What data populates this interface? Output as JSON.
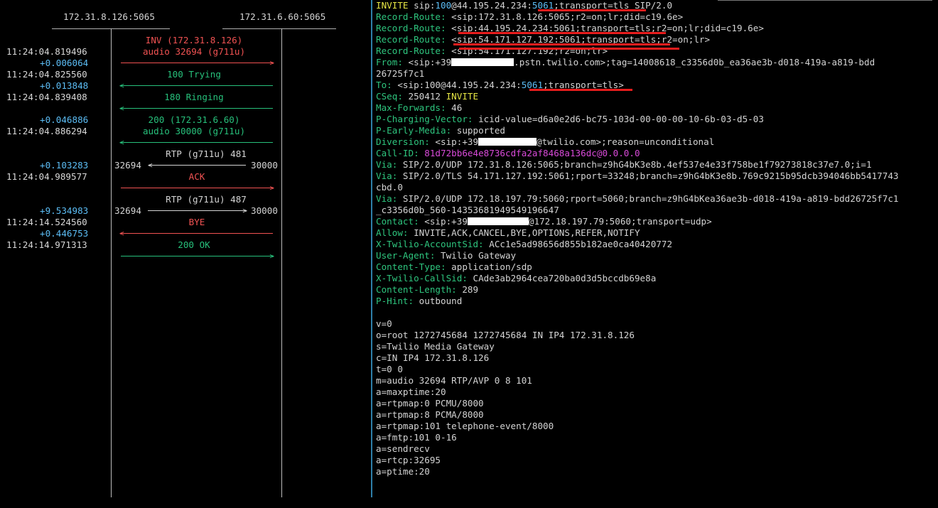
{
  "ladder": {
    "hosts": [
      "172.31.8.126:5065",
      "172.31.6.60:5065"
    ],
    "events": [
      {
        "timestamp": "",
        "delta": "",
        "label": "INV (172.31.8.126)",
        "color": "red"
      },
      {
        "timestamp": "11:24:04.819496",
        "delta": "",
        "label": "audio 32694 (g711u)",
        "color": "red"
      },
      {
        "timestamp": "",
        "delta": "+0.006064",
        "label": "",
        "color": ""
      },
      {
        "timestamp": "11:24:04.825560",
        "delta": "",
        "label": "100 Trying",
        "color": "green"
      },
      {
        "timestamp": "",
        "delta": "+0.013848",
        "label": "",
        "color": ""
      },
      {
        "timestamp": "11:24:04.839408",
        "delta": "",
        "label": "180 Ringing",
        "color": "green"
      },
      {
        "timestamp": "",
        "delta": "+0.046886",
        "label": "200 (172.31.6.60)",
        "color": "green"
      },
      {
        "timestamp": "11:24:04.886294",
        "delta": "",
        "label": "audio 30000 (g711u)",
        "color": "green"
      },
      {
        "timestamp": "",
        "delta": "",
        "label": "RTP (g711u) 481",
        "color": "grey"
      },
      {
        "timestamp": "",
        "delta": "+0.103283",
        "label": "",
        "color": ""
      },
      {
        "timestamp": "11:24:04.989577",
        "delta": "",
        "label": "ACK",
        "color": "red"
      },
      {
        "timestamp": "",
        "delta": "",
        "label": "RTP (g711u) 487",
        "color": "grey"
      },
      {
        "timestamp": "",
        "delta": "+9.534983",
        "label": "",
        "color": ""
      },
      {
        "timestamp": "11:24:14.524560",
        "delta": "",
        "label": "BYE",
        "color": "red"
      },
      {
        "timestamp": "",
        "delta": "+0.446753",
        "label": "",
        "color": ""
      },
      {
        "timestamp": "11:24:14.971313",
        "delta": "",
        "label": "200 OK",
        "color": "green"
      }
    ],
    "rtp_streams": [
      {
        "left_port": "32694",
        "right_port": "30000",
        "direction": "left"
      },
      {
        "left_port": "32694",
        "right_port": "30000",
        "direction": "right"
      }
    ]
  },
  "message": {
    "lines": [
      {
        "segments": [
          {
            "t": "INVITE",
            "c": "y"
          },
          {
            "t": " sip:",
            "c": ""
          },
          {
            "t": "100",
            "c": "lb"
          },
          {
            "t": "@44.195.24.234:",
            "c": ""
          },
          {
            "t": "5061",
            "c": "lb"
          },
          {
            "t": ";transport=tls SIP/2.0",
            "c": ""
          }
        ]
      },
      {
        "segments": [
          {
            "t": "Record-Route:",
            "c": "hn"
          },
          {
            "t": " <sip:172.31.8.126:5065;r2=on;lr;did=c19.6e>",
            "c": ""
          }
        ]
      },
      {
        "segments": [
          {
            "t": "Record-Route:",
            "c": "hn"
          },
          {
            "t": " <sip:44.195.24.234:5061;transport=tls;r2=on;lr;did=c19.6e>",
            "c": ""
          }
        ]
      },
      {
        "segments": [
          {
            "t": "Record-Route:",
            "c": "hn"
          },
          {
            "t": " <sip:54.171.127.192:5061;transport=tls;r2=on;lr>",
            "c": ""
          }
        ]
      },
      {
        "segments": [
          {
            "t": "Record-Route:",
            "c": "hn"
          },
          {
            "t": " <sip:54.171.127.192;r2=on;lr>",
            "c": ""
          }
        ]
      },
      {
        "segments": [
          {
            "t": "From:",
            "c": "hn"
          },
          {
            "t": " <sip:+39",
            "c": ""
          },
          {
            "t": "",
            "c": "redact",
            "w": 88
          },
          {
            "t": ".pstn.twilio.com>;tag=14008618_c3356d0b_ea36ae3b-d018-419a-a819-bdd",
            "c": ""
          }
        ]
      },
      {
        "segments": [
          {
            "t": "26725f7c1",
            "c": ""
          }
        ]
      },
      {
        "segments": [
          {
            "t": "To:",
            "c": "hn"
          },
          {
            "t": " <sip:100@44.195.24.234:",
            "c": ""
          },
          {
            "t": "5061",
            "c": "lb"
          },
          {
            "t": ";transport=tls>",
            "c": ""
          }
        ]
      },
      {
        "segments": [
          {
            "t": "CSeq:",
            "c": "hn"
          },
          {
            "t": " 250412 ",
            "c": ""
          },
          {
            "t": "INVITE",
            "c": "y"
          }
        ]
      },
      {
        "segments": [
          {
            "t": "Max-Forwards:",
            "c": "hn"
          },
          {
            "t": " 46",
            "c": ""
          }
        ]
      },
      {
        "segments": [
          {
            "t": "P-Charging-Vector:",
            "c": "hn"
          },
          {
            "t": " icid-value=d6a0e2d6-bc75-103d-00-00-00-10-6b-03-d5-03",
            "c": ""
          }
        ]
      },
      {
        "segments": [
          {
            "t": "P-Early-Media:",
            "c": "hn"
          },
          {
            "t": " supported",
            "c": ""
          }
        ]
      },
      {
        "segments": [
          {
            "t": "Diversion:",
            "c": "hn"
          },
          {
            "t": " <sip:+39",
            "c": ""
          },
          {
            "t": "",
            "c": "redact",
            "w": 82
          },
          {
            "t": "@twilio.com>;reason=unconditional",
            "c": ""
          }
        ]
      },
      {
        "segments": [
          {
            "t": "Call-ID:",
            "c": "hn"
          },
          {
            "t": " 81d72bb6e4e8736cdfa2af8468a136dc@0.0.0.0",
            "c": "cv"
          }
        ]
      },
      {
        "segments": [
          {
            "t": "Via:",
            "c": "hn"
          },
          {
            "t": " SIP/2.0/UDP 172.31.8.126:5065;branch=z9hG4bK3e8b.4ef537e4e33f758be1f79273818c37e7.0;i=1",
            "c": ""
          }
        ]
      },
      {
        "segments": [
          {
            "t": "Via:",
            "c": "hn"
          },
          {
            "t": " SIP/2.0/TLS 54.171.127.192:5061;rport=33248;branch=z9hG4bK3e8b.769c9215b95dcb394046bb5417743",
            "c": ""
          }
        ]
      },
      {
        "segments": [
          {
            "t": "cbd.0",
            "c": ""
          }
        ]
      },
      {
        "segments": [
          {
            "t": "Via:",
            "c": "hn"
          },
          {
            "t": " SIP/2.0/UDP 172.18.197.79:5060;rport=5060;branch=z9hG4bKea36ae3b-d018-419a-a819-bdd26725f7c1",
            "c": ""
          }
        ]
      },
      {
        "segments": [
          {
            "t": "_c3356d0b_560-14353681949549196647",
            "c": ""
          }
        ]
      },
      {
        "segments": [
          {
            "t": "Contact:",
            "c": "hn"
          },
          {
            "t": " <sip:+39",
            "c": ""
          },
          {
            "t": "",
            "c": "redact",
            "w": 86
          },
          {
            "t": "@172.18.197.79:5060;transport=udp>",
            "c": ""
          }
        ]
      },
      {
        "segments": [
          {
            "t": "Allow:",
            "c": "hn"
          },
          {
            "t": " INVITE,ACK,CANCEL,BYE,OPTIONS,REFER,NOTIFY",
            "c": ""
          }
        ]
      },
      {
        "segments": [
          {
            "t": "X-Twilio-AccountSid:",
            "c": "hn"
          },
          {
            "t": " ACc1e5ad98656d855b182ae0ca40420772",
            "c": ""
          }
        ]
      },
      {
        "segments": [
          {
            "t": "User-Agent:",
            "c": "hn"
          },
          {
            "t": " Twilio Gateway",
            "c": ""
          }
        ]
      },
      {
        "segments": [
          {
            "t": "Content-Type:",
            "c": "hn"
          },
          {
            "t": " application/sdp",
            "c": ""
          }
        ]
      },
      {
        "segments": [
          {
            "t": "X-Twilio-CallSid:",
            "c": "hn"
          },
          {
            "t": " CAde3ab2964cea720ba0d3d5bccdb69e8a",
            "c": ""
          }
        ]
      },
      {
        "segments": [
          {
            "t": "Content-Length:",
            "c": "hn"
          },
          {
            "t": " 289",
            "c": ""
          }
        ]
      },
      {
        "segments": [
          {
            "t": "P-Hint:",
            "c": "hn"
          },
          {
            "t": " outbound",
            "c": ""
          }
        ]
      },
      {
        "segments": []
      },
      {
        "segments": [
          {
            "t": "v=0",
            "c": ""
          }
        ]
      },
      {
        "segments": [
          {
            "t": "o=root 1272745684 1272745684 IN IP4 172.31.8.126",
            "c": ""
          }
        ]
      },
      {
        "segments": [
          {
            "t": "s=Twilio Media Gateway",
            "c": ""
          }
        ]
      },
      {
        "segments": [
          {
            "t": "c=IN IP4 172.31.8.126",
            "c": ""
          }
        ]
      },
      {
        "segments": [
          {
            "t": "t=0 0",
            "c": ""
          }
        ]
      },
      {
        "segments": [
          {
            "t": "m=audio 32694 RTP/AVP 0 8 101",
            "c": ""
          }
        ]
      },
      {
        "segments": [
          {
            "t": "a=maxptime:20",
            "c": ""
          }
        ]
      },
      {
        "segments": [
          {
            "t": "a=rtpmap:0 PCMU/8000",
            "c": ""
          }
        ]
      },
      {
        "segments": [
          {
            "t": "a=rtpmap:8 PCMA/8000",
            "c": ""
          }
        ]
      },
      {
        "segments": [
          {
            "t": "a=rtpmap:101 telephone-event/8000",
            "c": ""
          }
        ]
      },
      {
        "segments": [
          {
            "t": "a=fmtp:101 0-16",
            "c": ""
          }
        ]
      },
      {
        "segments": [
          {
            "t": "a=sendrecv",
            "c": ""
          }
        ]
      },
      {
        "segments": [
          {
            "t": "a=rtcp:32695",
            "c": ""
          }
        ]
      },
      {
        "segments": [
          {
            "t": "a=ptime:20",
            "c": ""
          }
        ]
      }
    ]
  },
  "colors": {
    "background": "#000000",
    "text": "#d4d4d4",
    "request": "#f05252",
    "response": "#27c07b",
    "delta": "#5cbdf5",
    "method": "#e6e645",
    "header": "#2ec57e",
    "call_id": "#d94ad9",
    "highlight": "#e81d1d",
    "divider": "#2e7fa8"
  }
}
